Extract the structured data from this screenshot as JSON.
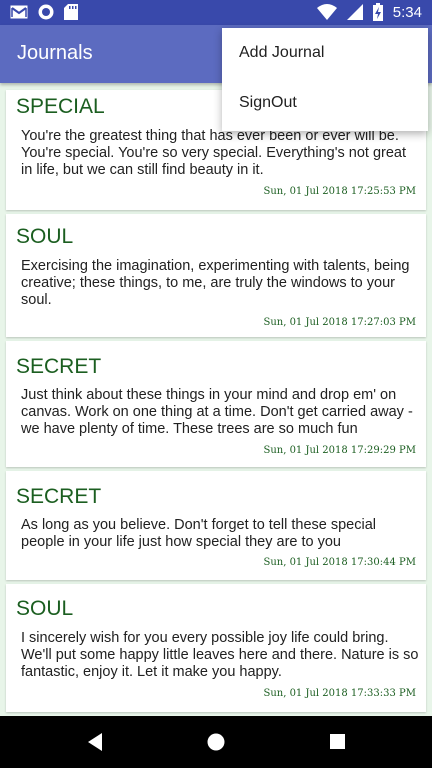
{
  "status_bar": {
    "time": "5:34",
    "icons_left": [
      "gmail-icon",
      "circle-app-icon",
      "sd-card-icon"
    ],
    "icons_right": [
      "wifi-icon",
      "signal-icon",
      "battery-icon"
    ]
  },
  "app_bar": {
    "title": "Journals",
    "color": "#5c6bc0"
  },
  "menu": {
    "items": [
      {
        "label": "Add Journal"
      },
      {
        "label": "SignOut"
      }
    ]
  },
  "journals": [
    {
      "title": "SPECIAL",
      "body": "You're the greatest thing that has ever been or ever will be. You're special. You're so very special. Everything's not great in life, but we can still find beauty in it.",
      "timestamp": "Sun, 01 Jul 2018 17:25:53 PM"
    },
    {
      "title": "SOUL",
      "body": "Exercising the imagination, experimenting with talents, being creative; these things, to me, are truly the windows to your soul.",
      "timestamp": "Sun, 01 Jul 2018 17:27:03 PM"
    },
    {
      "title": "SECRET",
      "body": "Just think about these things in your mind and drop em' on canvas. Work on one thing at a time. Don't get carried away - we have plenty of time. These trees are so much fun",
      "timestamp": "Sun, 01 Jul 2018 17:29:29 PM"
    },
    {
      "title": "SECRET",
      "body": "As long as you believe. Don't forget to tell these special people in your life just how special they are to you",
      "timestamp": "Sun, 01 Jul 2018 17:30:44 PM"
    },
    {
      "title": "SOUL",
      "body": "I sincerely wish for you every possible joy life could bring. We'll put some happy little leaves here and there. Nature is so fantastic, enjoy it. Let it make you happy.",
      "timestamp": "Sun, 01 Jul 2018 17:33:33 PM"
    }
  ],
  "nav_bar": {
    "buttons": [
      "back-icon",
      "home-icon",
      "recents-icon"
    ]
  }
}
